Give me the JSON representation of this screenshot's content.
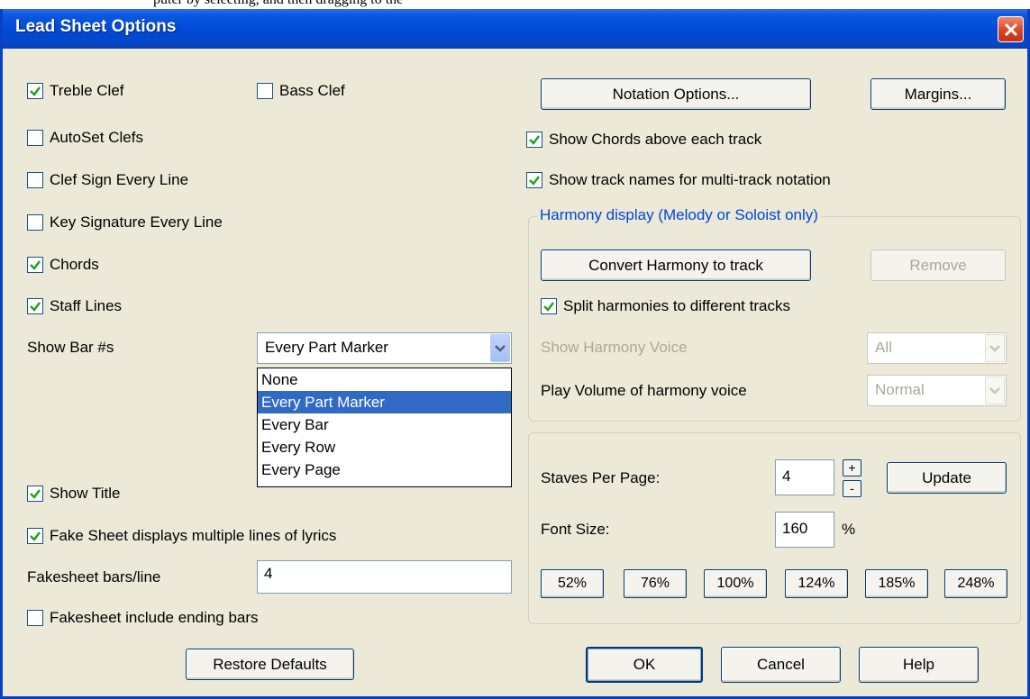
{
  "top_strip_text": "puter by selecting, and then dragging to the",
  "window": {
    "title": "Lead Sheet Options"
  },
  "left": {
    "treble_clef": {
      "label": "Treble Clef",
      "checked": true
    },
    "bass_clef": {
      "label": "Bass Clef",
      "checked": false
    },
    "autoset_clefs": {
      "label": "AutoSet Clefs",
      "checked": false
    },
    "clef_sign_every_line": {
      "label": "Clef Sign Every Line",
      "checked": false
    },
    "key_sig_every_line": {
      "label": "Key Signature Every Line",
      "checked": false
    },
    "chords": {
      "label": "Chords",
      "checked": true
    },
    "staff_lines": {
      "label": "Staff Lines",
      "checked": true
    },
    "show_bar_label": "Show Bar #s",
    "show_bar_value": "Every Part Marker",
    "show_bar_options": [
      "None",
      "Every Part Marker",
      "Every Bar",
      "Every Row",
      "Every Page"
    ],
    "show_bar_selected_index": 1,
    "show_title": {
      "label": "Show Title",
      "checked": true
    },
    "fake_sheet_lyrics": {
      "label": "Fake Sheet displays multiple lines of lyrics",
      "checked": true
    },
    "fakesheet_bars_label": "Fakesheet bars/line",
    "fakesheet_bars_value": "4",
    "fakesheet_ending": {
      "label": "Fakesheet include ending bars",
      "checked": false
    },
    "restore_defaults": "Restore Defaults"
  },
  "right": {
    "notation_options": "Notation Options...",
    "margins": "Margins...",
    "show_chords": {
      "label": "Show Chords above each track",
      "checked": true
    },
    "show_track_names": {
      "label": "Show track names for multi-track notation",
      "checked": true
    },
    "harmony": {
      "title": "Harmony display (Melody or Soloist only)",
      "convert": "Convert Harmony to track",
      "remove": "Remove",
      "split": {
        "label": "Split harmonies to different tracks",
        "checked": true
      },
      "show_voice_label": "Show Harmony Voice",
      "show_voice_value": "All",
      "play_volume_label": "Play Volume of harmony voice",
      "play_volume_value": "Normal"
    },
    "staves": {
      "label": "Staves Per Page:",
      "value": "4",
      "plus": "+",
      "minus": "-",
      "update": "Update",
      "font_size_label": "Font Size:",
      "font_size_value": "160",
      "percent": "%",
      "presets": [
        "52%",
        "76%",
        "100%",
        "124%",
        "185%",
        "248%"
      ]
    },
    "ok": "OK",
    "cancel": "Cancel",
    "help": "Help"
  }
}
